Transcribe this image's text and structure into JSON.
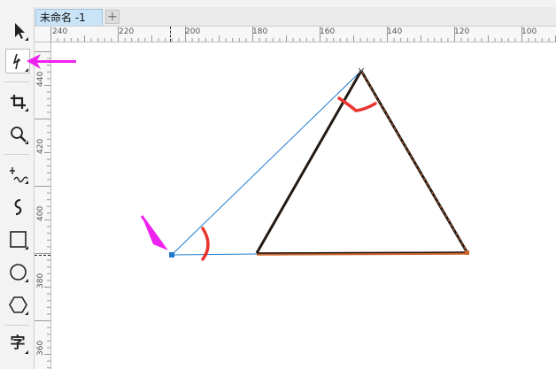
{
  "document": {
    "tab_title": "未命名 -1",
    "add_tab_label": "+"
  },
  "rulers": {
    "horizontal": [
      "240",
      "220",
      "200",
      "180",
      "160",
      "140",
      "120",
      "100"
    ],
    "vertical": [
      "440",
      "420",
      "400",
      "380",
      "360"
    ]
  },
  "toolbox": {
    "text_tool_glyph": "字"
  },
  "colors": {
    "toolbar_bg": "#f3f3f3",
    "tab_active": "#c9e3f7",
    "guide_line": "#1f7acc",
    "triangle_stroke": "#241a14",
    "base_outline": "#c8622a",
    "annotation_red": "#e8352f",
    "pointer_magenta": "#ee22ee"
  }
}
